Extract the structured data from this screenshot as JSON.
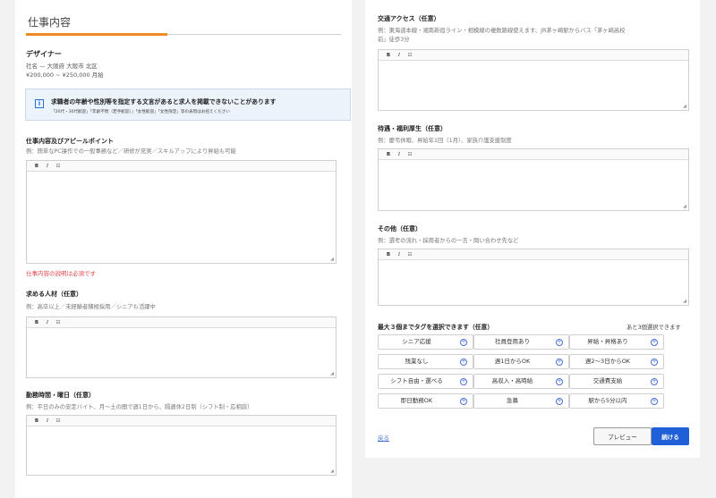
{
  "section": {
    "title": "仕事内容"
  },
  "job": {
    "title": "デザイナー",
    "company_location": "社名 — 大阪府 大阪市 北区",
    "salary": "¥200,000 ~ ¥250,000 月給"
  },
  "notice": {
    "title": "求職者の年齢や性別等を指定する文言があると求人を掲載できないことがあります",
    "detail": "「20代・30代歓迎」「年齢不問（若手歓迎）」「女性歓迎」「女性限定」等の表現はお控えください"
  },
  "editor_toolbar": {
    "bold": "B",
    "italic": "I",
    "list": "☷"
  },
  "fields": {
    "appeal": {
      "label": "仕事内容及びアピールポイント",
      "hint": "例：簡単なPC操作での一般事務など／研修が充実／スキルアップにより昇給も可能",
      "error": "仕事内容の説明は必須です"
    },
    "requirements": {
      "label": "求める人材（任意）",
      "hint": "例：高卒以上／未経験者積極採用／シニアも活躍中"
    },
    "hours": {
      "label": "勤務時間・曜日（任意）",
      "hint": "例：平日のみの安定バイト、月～土の間で週1日から、隔週休2日制（シフト制・応相談）"
    },
    "access": {
      "label": "交通アクセス（任意）",
      "hint_line1": "例：東海道本線・湘南新宿ライン・相模線の複数路線使えます、JR茅ヶ崎駅からバス「茅ヶ崎高校",
      "hint_line2": "前」徒歩3分"
    },
    "benefits": {
      "label": "待遇・福利厚生（任意）",
      "hint": "例：慶弔休暇、昇給年1回（1月）、家族介護支援制度"
    },
    "other": {
      "label": "その他（任意）",
      "hint": "例：選考の流れ・採用者からの一言・問い合わせ先など"
    }
  },
  "tags": {
    "label": "最大３個までタグを選択できます（任意）",
    "remaining": "あと3個選択できます",
    "items": [
      "シニア応援",
      "社員登用あり",
      "昇給・昇格あり",
      "残業なし",
      "週1日からOK",
      "週2〜3日からOK",
      "シフト自由・選べる",
      "高収入・高時給",
      "交通費支給",
      "即日勤務OK",
      "急募",
      "駅から5分以内"
    ]
  },
  "actions": {
    "back": "戻る",
    "preview": "プレビュー",
    "next": "続ける"
  }
}
